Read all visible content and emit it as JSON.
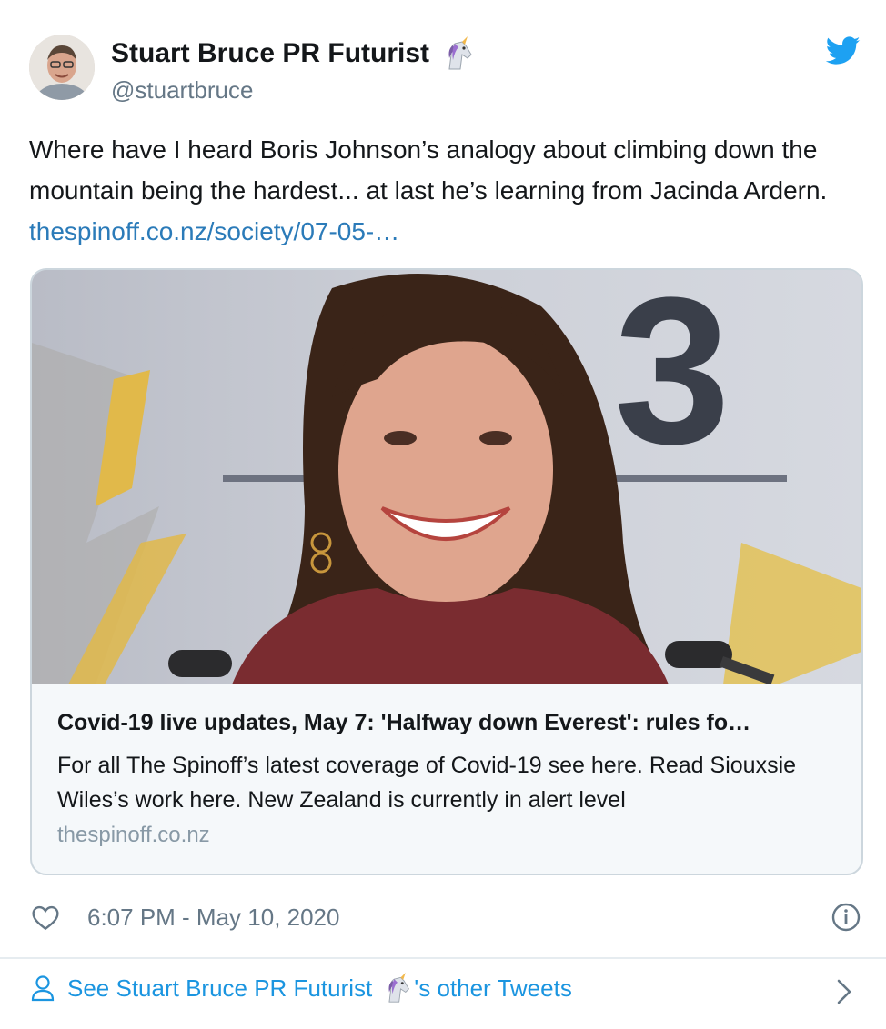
{
  "author": {
    "name": "Stuart Bruce PR Futurist",
    "handle": "@stuartbruce"
  },
  "tweet": {
    "text": "Where have I heard Boris Johnson’s analogy about climbing down the mountain being the hardest... at last he’s learning from Jacinda Ardern. ",
    "link": "thespinoff.co.nz/society/07-05-…"
  },
  "card": {
    "image_sign_text": "3",
    "title": "Covid-19 live updates, May 7: 'Halfway down Everest': rules fo…",
    "description": "For all The Spinoff’s latest coverage of Covid-19 see here. Read Siouxsie Wiles’s work here. New Zealand is currently in alert level",
    "domain": "thespinoff.co.nz"
  },
  "meta": {
    "timestamp": "6:07 PM - May 10, 2020"
  },
  "footer": {
    "prefix": "See Stuart Bruce PR Futurist",
    "suffix": "'s other Tweets"
  },
  "colors": {
    "link": "#1b95e0",
    "twitter_blue": "#1da1f2",
    "muted": "#657786"
  },
  "icons": [
    "avatar-image",
    "unicorn-emoji",
    "twitter-bird-icon",
    "heart-icon",
    "info-icon",
    "person-icon",
    "chevron-right-icon"
  ]
}
